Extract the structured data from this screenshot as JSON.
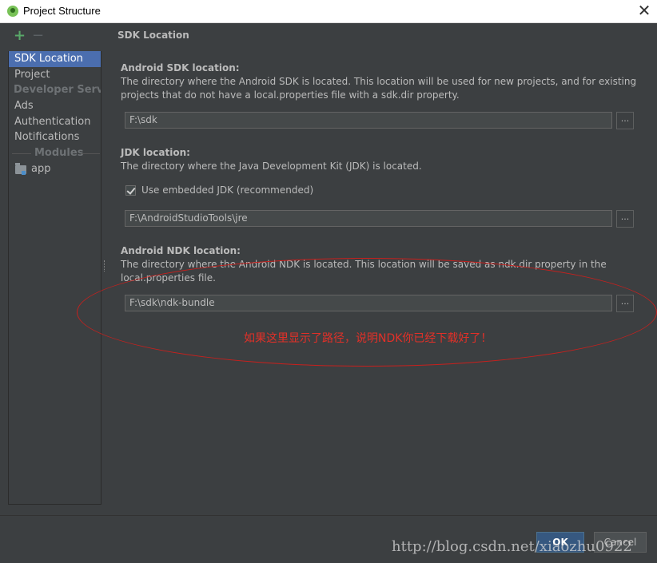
{
  "window": {
    "title": "Project Structure",
    "close_symbol": "✕"
  },
  "toolbar": {
    "add_symbol": "+",
    "remove_symbol": "−"
  },
  "sidebar": {
    "items": [
      {
        "label": "SDK Location"
      },
      {
        "label": "Project"
      },
      {
        "label": "Developer Servi..."
      },
      {
        "label": "Ads"
      },
      {
        "label": "Authentication"
      },
      {
        "label": "Notifications"
      }
    ],
    "modules_label": "Modules",
    "module_items": [
      {
        "label": "app"
      }
    ]
  },
  "main": {
    "heading": "SDK Location",
    "android_sdk": {
      "label": "Android SDK location:",
      "description": "The directory where the Android SDK is located. This location will be used for new projects, and for existing projects that do not have a local.properties file with a sdk.dir property.",
      "value": "F:\\sdk",
      "browse_label": "..."
    },
    "jdk": {
      "label": "JDK location:",
      "description": "The directory where the Java Development Kit (JDK) is located.",
      "checkbox_label": "Use embedded JDK (recommended)",
      "checkbox_checked": true,
      "value": "F:\\AndroidStudioTools\\jre",
      "browse_label": "..."
    },
    "android_ndk": {
      "label": "Android NDK location:",
      "description": "The directory where the Android NDK is located. This location will be saved as ndk.dir property in the local.properties file.",
      "value": "F:\\sdk\\ndk-bundle",
      "browse_label": "..."
    }
  },
  "annotation": {
    "text": "如果这里显示了路径，说明NDK你已经下载好了！",
    "color": "#e23028"
  },
  "footer": {
    "ok_label": "OK",
    "cancel_label": "Cancel"
  },
  "watermark": {
    "text": "http://blog.csdn.net/xiaozhu0922"
  },
  "colors": {
    "background": "#3c3f41",
    "selection": "#4b6eaf",
    "text": "#bbbbbb",
    "add_green": "#59a869",
    "annotation_red": "#c8201d"
  }
}
